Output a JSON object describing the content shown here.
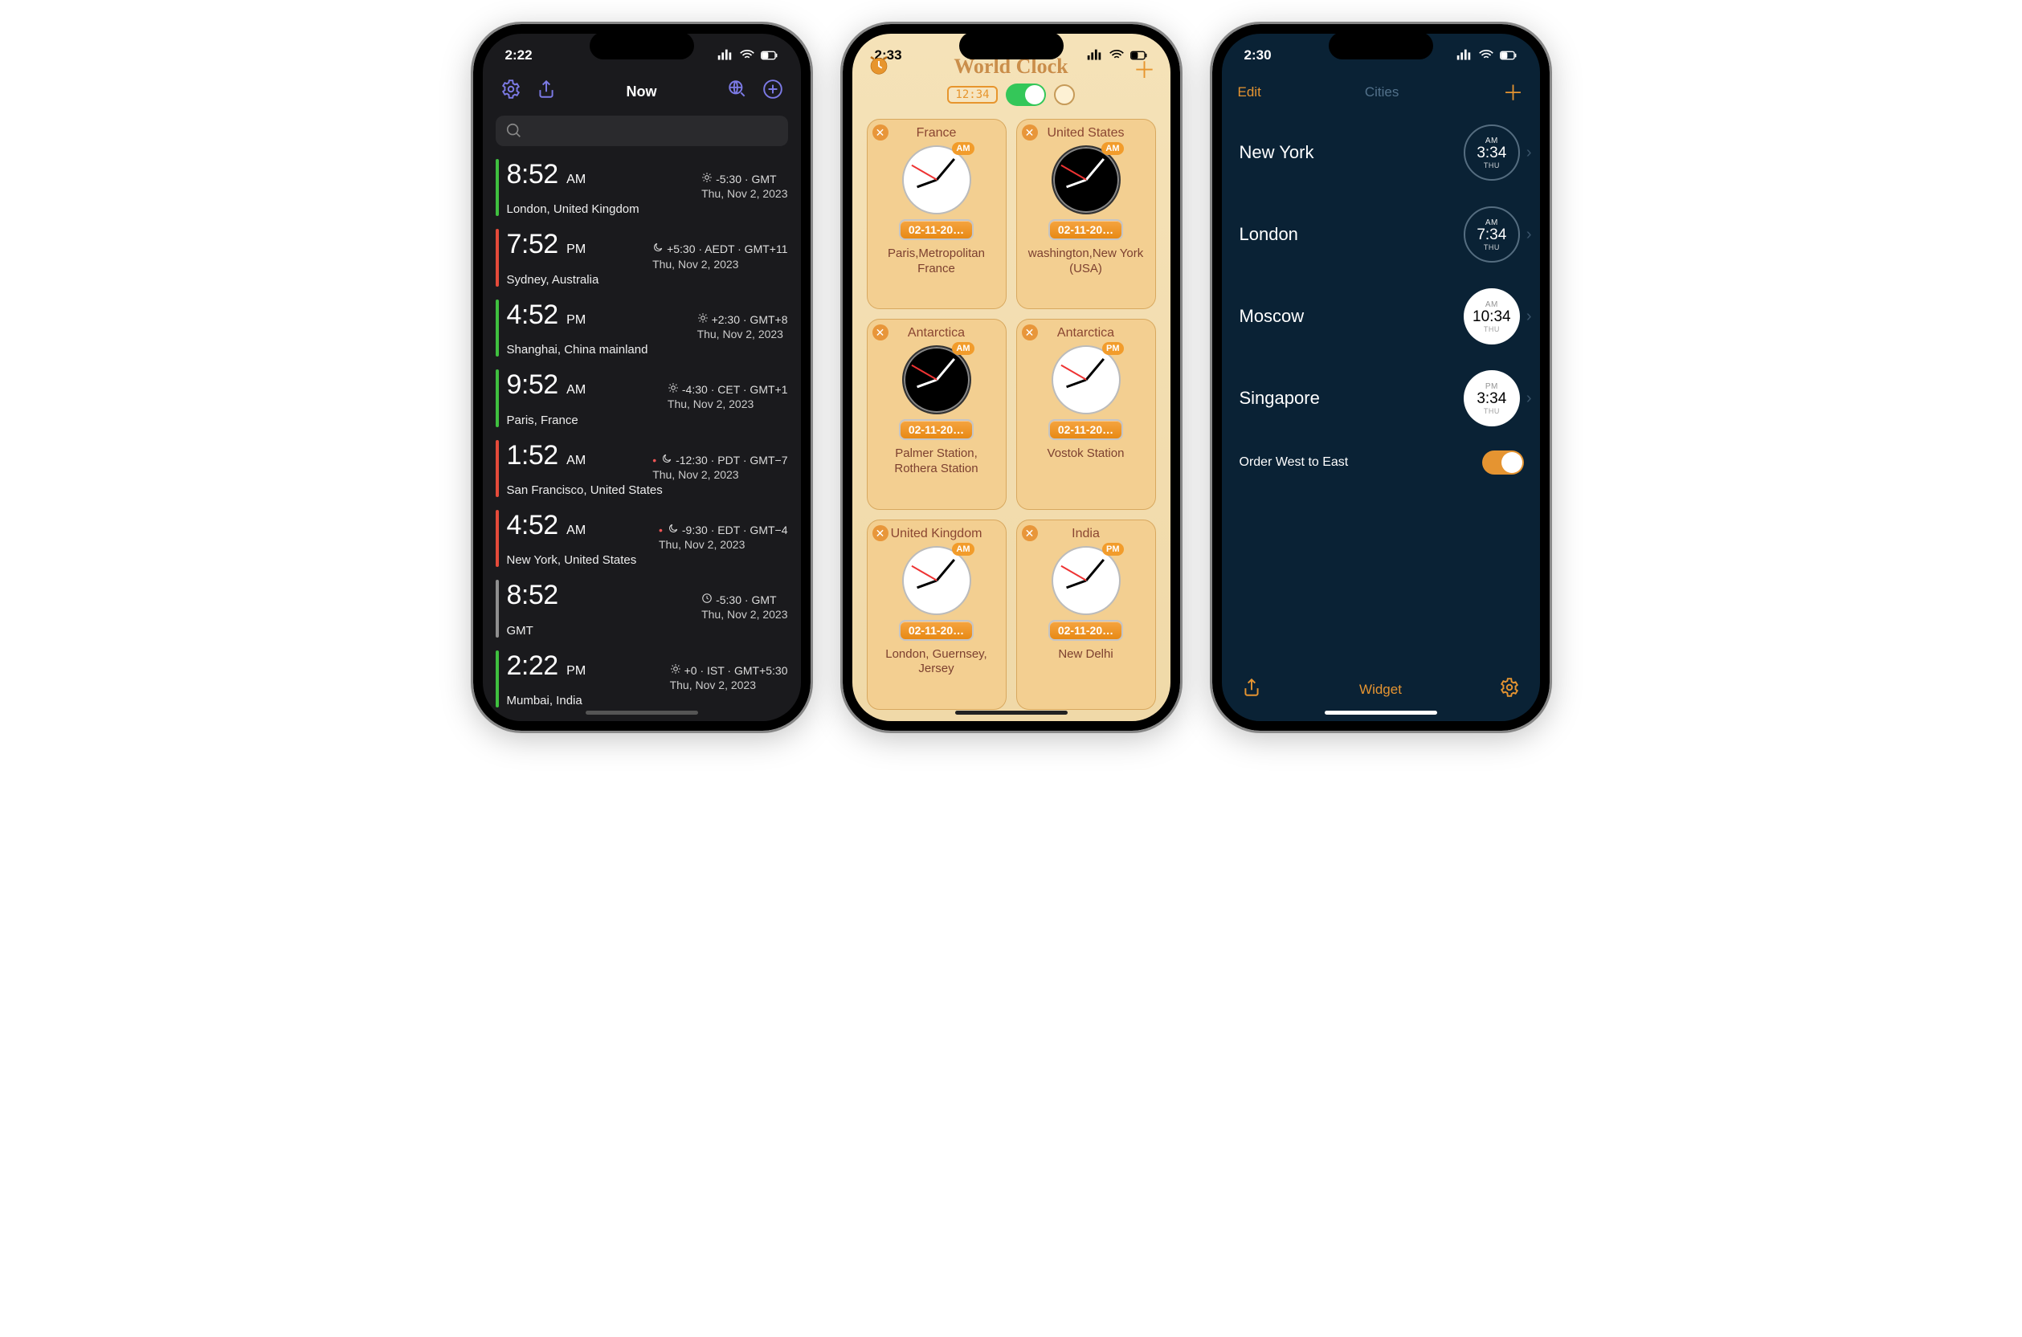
{
  "phone1": {
    "status_time": "2:22",
    "title": "Now",
    "rows": [
      {
        "stripe": "#3fbf3f",
        "time": "8:52",
        "ampm": "AM",
        "icon": "sun",
        "offset": "-5:30 · GMT",
        "date": "Thu, Nov 2, 2023",
        "city": "London, United Kingdom"
      },
      {
        "stripe": "#e44a3a",
        "time": "7:52",
        "ampm": "PM",
        "icon": "moon",
        "offset": "+5:30 · AEDT · GMT+11",
        "date": "Thu, Nov 2, 2023",
        "city": "Sydney, Australia"
      },
      {
        "stripe": "#3fbf3f",
        "time": "4:52",
        "ampm": "PM",
        "icon": "sun",
        "offset": "+2:30 · GMT+8",
        "date": "Thu, Nov 2, 2023",
        "city": "Shanghai, China mainland"
      },
      {
        "stripe": "#3fbf3f",
        "time": "9:52",
        "ampm": "AM",
        "icon": "sun",
        "offset": "-4:30 · CET · GMT+1",
        "date": "Thu, Nov 2, 2023",
        "city": "Paris, France"
      },
      {
        "stripe": "#e44a3a",
        "time": "1:52",
        "ampm": "AM",
        "icon": "moon",
        "reddot": true,
        "offset": "-12:30 · PDT · GMT−7",
        "date": "Thu, Nov 2, 2023",
        "city": "San Francisco, United States"
      },
      {
        "stripe": "#e44a3a",
        "time": "4:52",
        "ampm": "AM",
        "icon": "moon",
        "reddot": true,
        "offset": "-9:30 · EDT · GMT−4",
        "date": "Thu, Nov 2, 2023",
        "city": "New York, United States"
      },
      {
        "stripe": "#8f8f8f",
        "time": "8:52",
        "ampm": "",
        "icon": "clock",
        "offset": "-5:30 · GMT",
        "date": "Thu, Nov 2, 2023",
        "city": "GMT"
      },
      {
        "stripe": "#3fbf3f",
        "time": "2:22",
        "ampm": "PM",
        "icon": "sun",
        "offset": "+0 · IST · GMT+5:30",
        "date": "Thu, Nov 2, 2023",
        "city": "Mumbai, India"
      }
    ]
  },
  "phone2": {
    "status_time": "2:33",
    "title": "World Clock",
    "digital_label": "12:34",
    "date_pill": "02-11-20…",
    "tiles": [
      {
        "country": "France",
        "face": "light",
        "ampm": "AM",
        "loc": "Paris,Metropolitan France"
      },
      {
        "country": "United States",
        "face": "dark",
        "ampm": "AM",
        "loc": "washington,New York (USA)"
      },
      {
        "country": "Antarctica",
        "face": "dark",
        "ampm": "AM",
        "loc": "Palmer Station, Rothera Station"
      },
      {
        "country": "Antarctica",
        "face": "light",
        "ampm": "PM",
        "loc": "Vostok Station"
      },
      {
        "country": "United Kingdom",
        "face": "light",
        "ampm": "AM",
        "loc": "London, Guernsey, Jersey"
      },
      {
        "country": "India",
        "face": "light",
        "ampm": "PM",
        "loc": "New Delhi"
      }
    ]
  },
  "phone3": {
    "status_time": "2:30",
    "edit_label": "Edit",
    "title": "Cities",
    "cities": [
      {
        "name": "New York",
        "ampm": "AM",
        "time": "3:34",
        "day": "THU",
        "style": "outline"
      },
      {
        "name": "London",
        "ampm": "AM",
        "time": "7:34",
        "day": "THU",
        "style": "outline"
      },
      {
        "name": "Moscow",
        "ampm": "AM",
        "time": "10:34",
        "day": "THU",
        "style": "filled"
      },
      {
        "name": "Singapore",
        "ampm": "PM",
        "time": "3:34",
        "day": "THU",
        "style": "filled"
      }
    ],
    "setting_label": "Order West to East",
    "tab_label": "Widget"
  }
}
